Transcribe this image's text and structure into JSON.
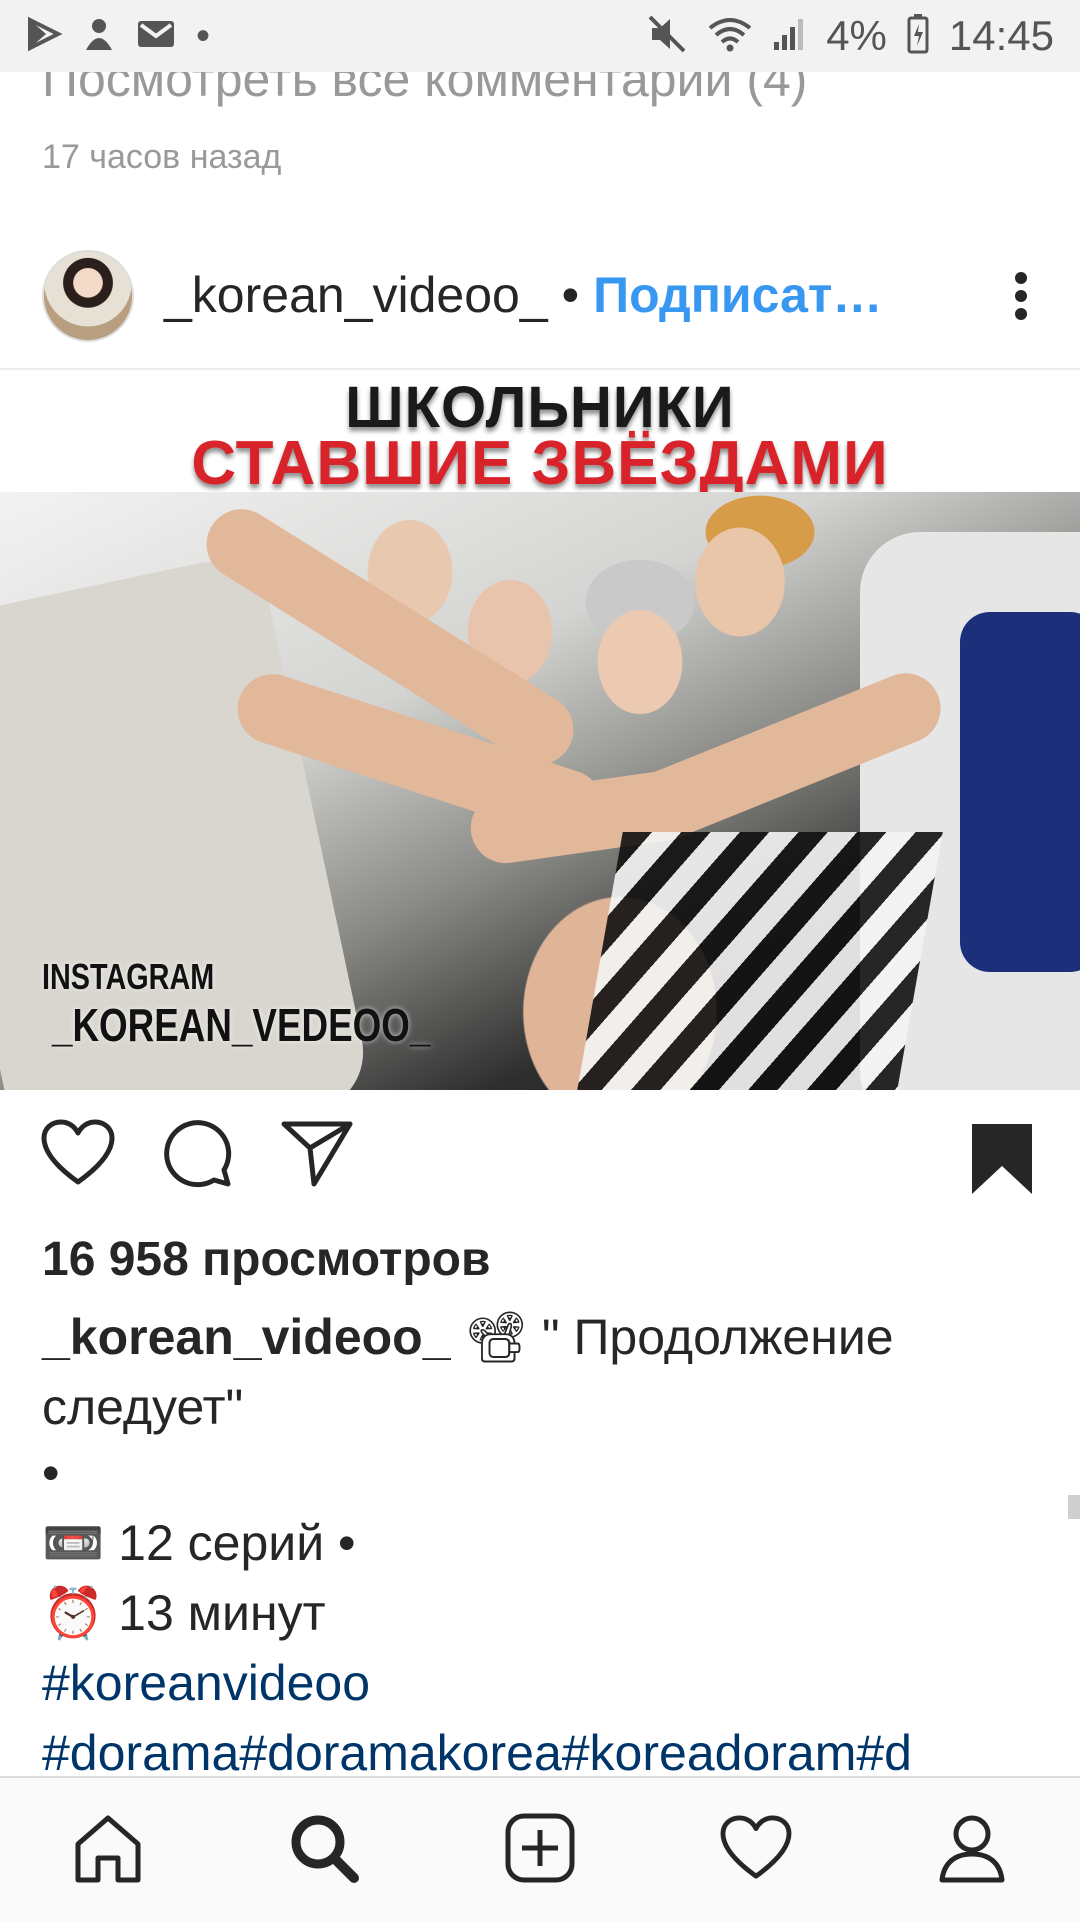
{
  "status_bar": {
    "battery": "4%",
    "time": "14:45",
    "icons_left": [
      "play-store-icon",
      "notification-app-icon",
      "gmail-icon",
      "dot-icon"
    ],
    "icons_right": [
      "mute-icon",
      "wifi-icon",
      "signal-icon",
      "battery-icon"
    ]
  },
  "previous_post": {
    "view_all_comments": "Посмотреть все комментарии (4)",
    "time_ago": "17 часов назад"
  },
  "post": {
    "author": "_korean_videoo_",
    "separator": "•",
    "follow_label": "Подписат…",
    "media": {
      "title_line1": "ШКОЛЬНИКИ",
      "title_line2": "СТАВШИЕ ЗВЁЗДАМИ",
      "title_line2_color": "#d9232a",
      "watermark_line1": "INSTAGRAM",
      "watermark_line2": "_KOREAN_VEDEOO_"
    },
    "views": "16 958 просмотров",
    "caption": {
      "username": "_korean_videoo_",
      "emoji": "📽",
      "text": " \" Продолжение следует\"",
      "dot_line": "•",
      "episodes": "📼 12 серий •",
      "duration": "⏰ 13 минут",
      "hashtag1": "#koreanvideoo",
      "hashtag2": "#dorama#doramakorea#koreadoram#d"
    },
    "saved": true
  },
  "bottom_nav": {
    "items": [
      "home-icon",
      "search-icon",
      "add-post-icon",
      "activity-heart-icon",
      "profile-icon"
    ],
    "active": "search-icon"
  },
  "colors": {
    "link_blue": "#3897f0",
    "hashtag_navy": "#003569",
    "text": "#262626",
    "muted": "#999999"
  }
}
